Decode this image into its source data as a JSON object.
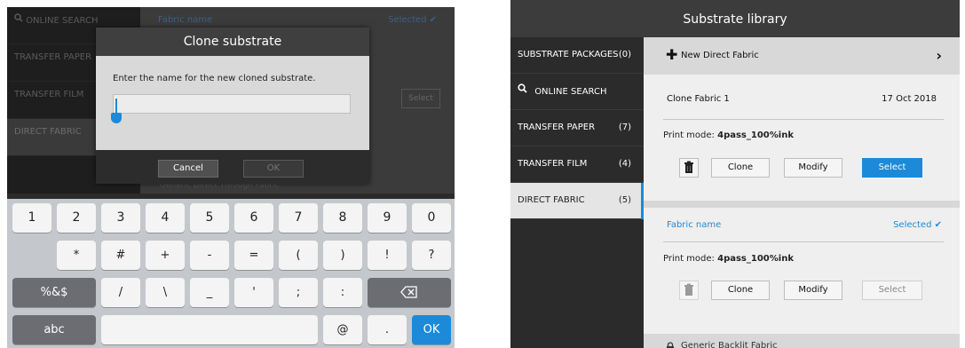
{
  "left_panel": {
    "background_sidebar": [
      {
        "label": "ONLINE SEARCH",
        "icon": "search-icon"
      },
      {
        "label": "TRANSFER PAPER"
      },
      {
        "label": "TRANSFER FILM"
      },
      {
        "label": "DIRECT FABRIC",
        "active": true
      }
    ],
    "background_main": {
      "fabric_name": "Fabric name",
      "selected_label": "Selected ✔",
      "select_label": "Select",
      "generic_label": "Generic Direct Through Fabric"
    },
    "dialog": {
      "title": "Clone substrate",
      "prompt": "Enter the name for the new cloned substrate.",
      "input_value": "",
      "cancel_label": "Cancel",
      "ok_label": "OK"
    },
    "keyboard": {
      "row1": [
        "1",
        "2",
        "3",
        "4",
        "5",
        "6",
        "7",
        "8",
        "9",
        "0"
      ],
      "row2": [
        "*",
        "#",
        "+",
        "-",
        "=",
        "(",
        ")",
        "!",
        "?"
      ],
      "row3": [
        "%&$",
        "/",
        "\\",
        "_",
        "'",
        ";",
        ":",
        ","
      ],
      "row4": [
        "abc",
        "",
        "@",
        ".",
        "OK"
      ],
      "backspace_icon": "backspace-icon",
      "accent_color": "#1c8ad8"
    }
  },
  "right_panel": {
    "title": "Substrate library",
    "sidebar": [
      {
        "label": "SUBSTRATE PACKAGES",
        "count": "(0)"
      },
      {
        "label": "ONLINE SEARCH",
        "count": "",
        "icon": "search-icon"
      },
      {
        "label": "TRANSFER PAPER",
        "count": "(7)"
      },
      {
        "label": "TRANSFER FILM",
        "count": "(4)"
      },
      {
        "label": "DIRECT FABRIC",
        "count": "(5)",
        "active": true
      }
    ],
    "new_direct_fabric": "New Direct Fabric",
    "cards": [
      {
        "name": "Clone Fabric 1",
        "date": "17 Oct 2018",
        "print_mode_label": "Print mode:",
        "print_mode_value": "4pass_100%ink",
        "clone_label": "Clone",
        "modify_label": "Modify",
        "select_label": "Select"
      },
      {
        "name": "Fabric name",
        "selected_label": "Selected ✔",
        "print_mode_label": "Print mode:",
        "print_mode_value": "4pass_100%ink",
        "clone_label": "Clone",
        "modify_label": "Modify",
        "select_label": "Select"
      }
    ],
    "bottom_item": "Generic Backlit Fabric",
    "accent_color": "#1c8ad8"
  }
}
